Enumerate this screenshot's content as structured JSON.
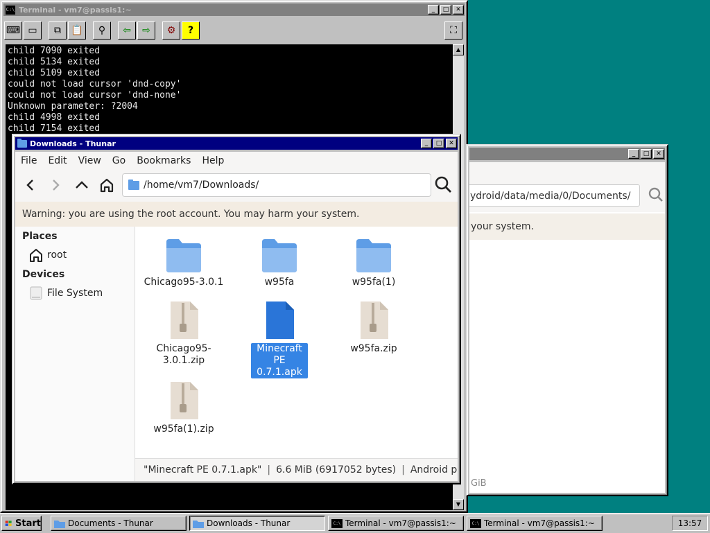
{
  "terminal": {
    "title": "Terminal - vm7@passis1:~",
    "lines": [
      "child 7090 exited",
      "child 5134 exited",
      "child 5109 exited",
      "could not load cursor 'dnd-copy'",
      "could not load cursor 'dnd-none'",
      "Unknown parameter: ?2004",
      "child 4998 exited",
      "child 7154 exited"
    ]
  },
  "documents_window": {
    "path_fragment": "ydroid/data/media/0/Documents/",
    "warning_fragment": "your system.",
    "status_fragment": "GiB"
  },
  "thunar": {
    "title": "Downloads - Thunar",
    "menu": [
      "File",
      "Edit",
      "View",
      "Go",
      "Bookmarks",
      "Help"
    ],
    "location": "/home/vm7/Downloads/",
    "warning": "Warning: you are using the root account. You may harm your system.",
    "places_heading": "Places",
    "devices_heading": "Devices",
    "places": [
      {
        "label": "root",
        "icon": "home-icon"
      }
    ],
    "devices": [
      {
        "label": "File System",
        "icon": "drive-icon"
      }
    ],
    "files": [
      {
        "name": "Chicago95-3.0.1",
        "type": "folder"
      },
      {
        "name": "w95fa",
        "type": "folder"
      },
      {
        "name": "w95fa(1)",
        "type": "folder"
      },
      {
        "name": "Chicago95-3.0.1.zip",
        "type": "zip"
      },
      {
        "name": "Minecraft PE 0.7.1.apk",
        "type": "apk",
        "selected": true
      },
      {
        "name": "w95fa.zip",
        "type": "zip"
      },
      {
        "name": "w95fa(1).zip",
        "type": "zip"
      }
    ],
    "status": {
      "name": "\"Minecraft PE 0.7.1.apk\"",
      "size": "6.6 MiB (6917052 bytes)",
      "kind": "Android package",
      "separator": "|"
    }
  },
  "taskbar": {
    "start_label": "Start",
    "tasks": [
      {
        "label": "Documents - Thunar",
        "icon": "folder-icon"
      },
      {
        "label": "Downloads - Thunar",
        "icon": "folder-icon",
        "active": true
      },
      {
        "label": "Terminal - vm7@passis1:~",
        "icon": "terminal-icon"
      },
      {
        "label": "Terminal - vm7@passis1:~",
        "icon": "terminal-icon"
      }
    ],
    "clock": "13:57"
  },
  "colors": {
    "desktop": "#008080",
    "selection": "#3584e4",
    "folder": "#5e9de6",
    "active_title": "#000080"
  }
}
